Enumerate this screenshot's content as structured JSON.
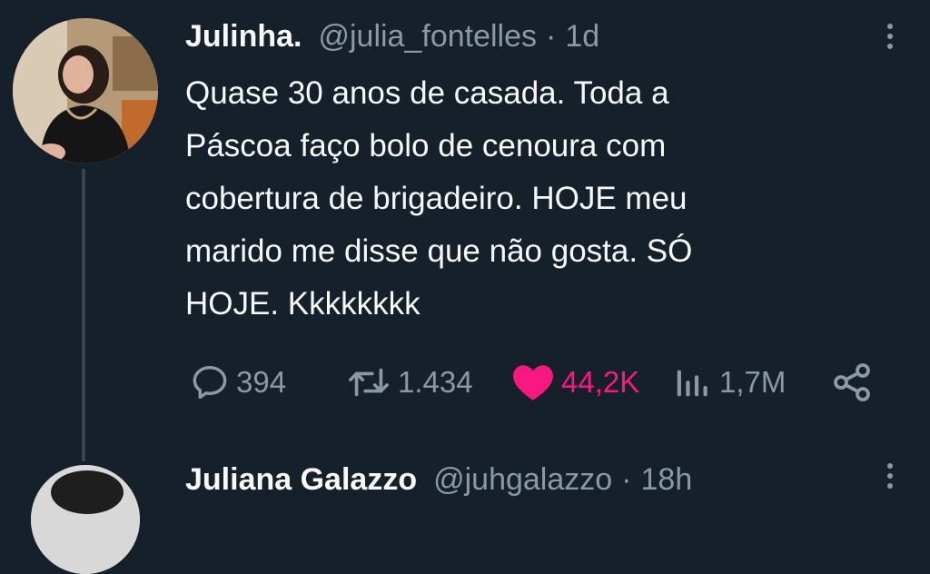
{
  "tweet": {
    "author_name": "Julinha.",
    "handle": "@julia_fontelles",
    "separator": "·",
    "time": "1d",
    "text": "Quase 30 anos de casada. Toda a Páscoa faço bolo de cenoura com cobertura de brigadeiro. HOJE meu marido me disse que não gosta. SÓ HOJE. Kkkkkkkk",
    "text_lines": [
      "Quase 30 anos de casada. Toda a",
      "Páscoa faço bolo de cenoura com",
      "cobertura de brigadeiro. HOJE meu",
      "marido me disse que não gosta. SÓ",
      "HOJE. Kkkkkkkk"
    ],
    "actions": {
      "replies": "394",
      "retweets": "1.434",
      "likes": "44,2K",
      "views": "1,7M"
    },
    "like_active": true,
    "colors": {
      "background": "#15202b",
      "text": "#f7f9f9",
      "muted": "#8b98a5",
      "like": "#f91880",
      "thread_line": "#38444d"
    }
  },
  "next_tweet": {
    "author_name": "Juliana Galazzo",
    "handle": "@juhgalazzo",
    "separator": "·",
    "time": "18h"
  },
  "icons": {
    "reply": "speech-bubble-icon",
    "retweet": "retweet-arrows-icon",
    "like": "heart-filled-icon",
    "views": "bar-chart-icon",
    "share": "share-nodes-icon",
    "more": "vertical-ellipsis-icon"
  }
}
